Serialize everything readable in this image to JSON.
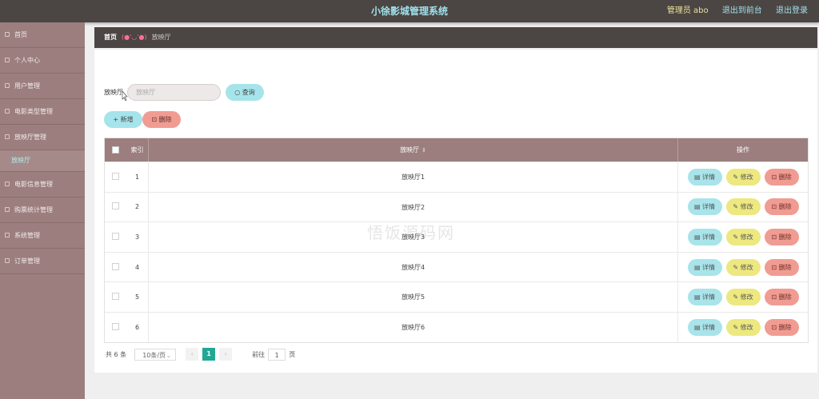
{
  "header": {
    "title": "小徐影城管理系统",
    "admin": "管理员 abo",
    "to_front": "退出到前台",
    "logout": "退出登录"
  },
  "sidebar": {
    "items": [
      {
        "label": "首页"
      },
      {
        "label": "个人中心"
      },
      {
        "label": "用户管理"
      },
      {
        "label": "电影类型管理"
      },
      {
        "label": "放映厅管理"
      },
      {
        "label": "电影信息管理"
      },
      {
        "label": "购票统计管理"
      },
      {
        "label": "系统管理"
      },
      {
        "label": "订单管理"
      }
    ],
    "submenu": {
      "label": "放映厅"
    }
  },
  "breadcrumb": {
    "home": "首页",
    "emote": "(●'◡'●)",
    "current": "放映厅"
  },
  "search": {
    "label": "放映厅",
    "placeholder": "放映厅",
    "query_label": "查询"
  },
  "toolbar": {
    "add_label": "新增",
    "delete_label": "删除"
  },
  "table": {
    "headers": {
      "index": "索引",
      "name": "放映厅",
      "ops": "操作"
    },
    "rows": [
      {
        "index": "1",
        "name": "放映厅1"
      },
      {
        "index": "2",
        "name": "放映厅2"
      },
      {
        "index": "3",
        "name": "放映厅3"
      },
      {
        "index": "4",
        "name": "放映厅4"
      },
      {
        "index": "5",
        "name": "放映厅5"
      },
      {
        "index": "6",
        "name": "放映厅6"
      }
    ],
    "op_labels": {
      "detail": "详情",
      "edit": "修改",
      "remove": "删除"
    }
  },
  "pagination": {
    "total": "共 6 条",
    "page_size": "10条/页",
    "current_page": "1",
    "goto_label": "前往",
    "goto_value": "1",
    "page_unit": "页"
  },
  "watermark": "悟饭源码网",
  "colors": {
    "topbar": "#4b4543",
    "sidebar": "#9b7e7d",
    "accent_cyan": "#a5e4ea",
    "accent_yellow": "#ede87f",
    "accent_red": "#f19c92",
    "page_active": "#22a894"
  }
}
